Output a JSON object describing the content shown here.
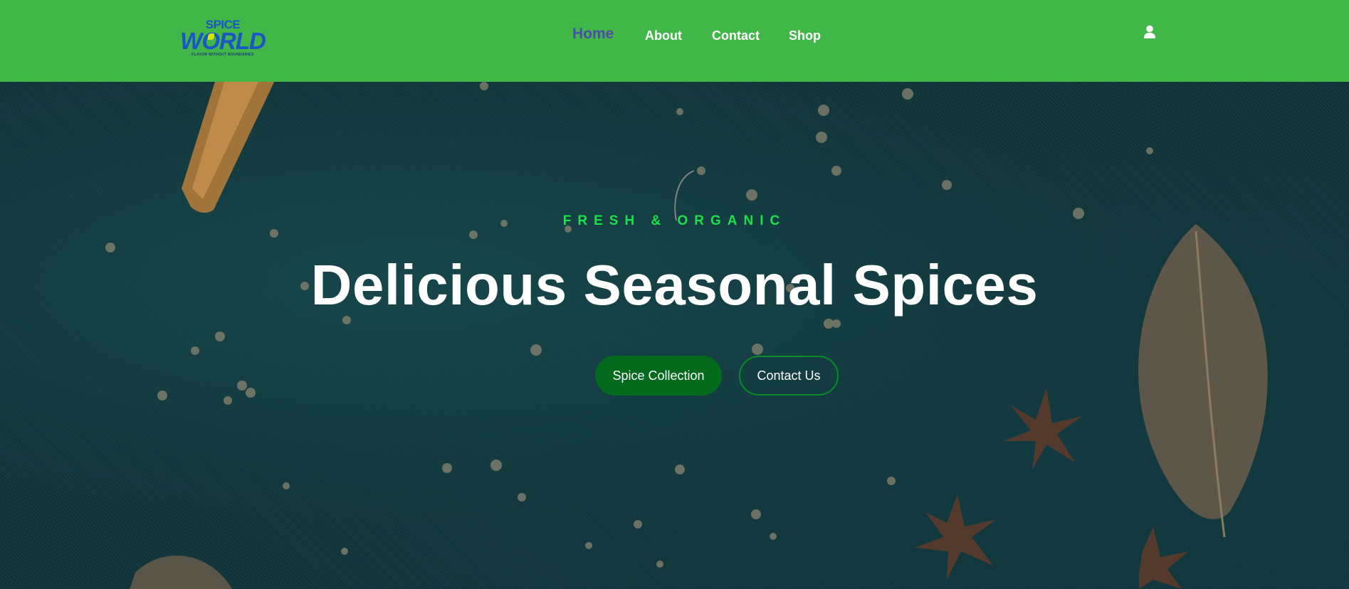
{
  "logo": {
    "top": "SPICE",
    "main_left": "W",
    "main_o": "O",
    "main_right": "RLD",
    "tagline": "FLAVOR WITHOUT BOUNDARIES"
  },
  "nav": {
    "items": [
      {
        "label": "Home",
        "active": true
      },
      {
        "label": "About",
        "active": false
      },
      {
        "label": "Contact",
        "active": false
      },
      {
        "label": "Shop",
        "active": false
      }
    ],
    "user_icon": "user-icon"
  },
  "hero": {
    "eyebrow": "FRESH & ORGANIC",
    "headline": "Delicious Seasonal Spices",
    "primary_button": "Spice Collection",
    "secondary_button": "Contact Us"
  },
  "colors": {
    "navbar": "#41b649",
    "nav_active": "#4b4fa6",
    "eyebrow": "#1ee04a",
    "primary_button": "#036a1e",
    "hero_background": "#10353a"
  }
}
